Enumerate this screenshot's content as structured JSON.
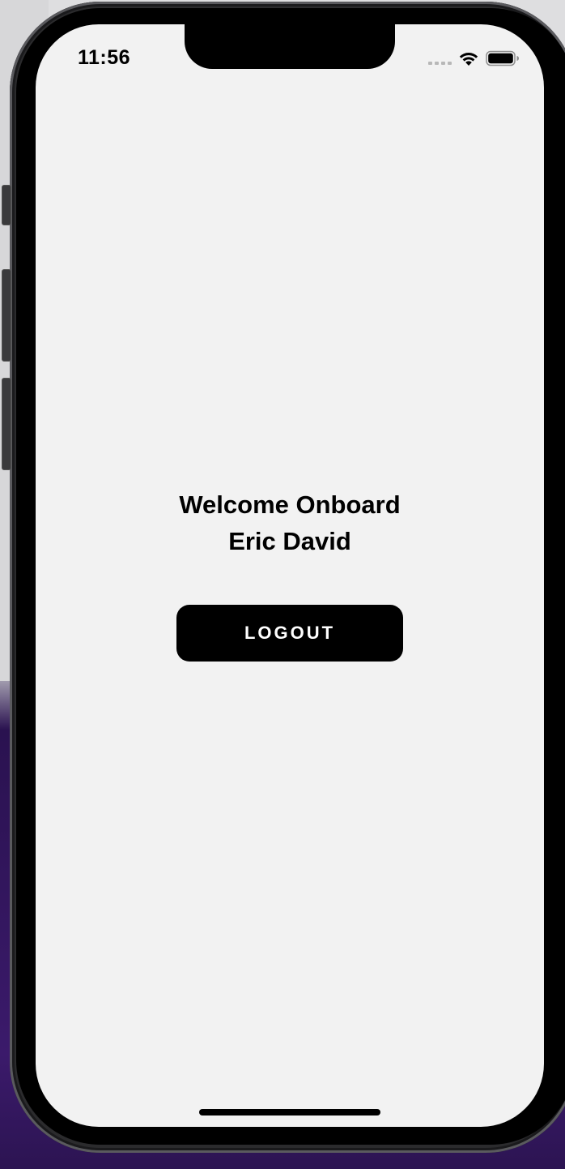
{
  "status_bar": {
    "time": "11:56",
    "icons": [
      "cellular-signal-icon",
      "wifi-icon",
      "battery-icon"
    ]
  },
  "main": {
    "welcome_title": "Welcome Onboard",
    "user_name": "Eric David",
    "logout_label": "LOGOUT"
  },
  "colors": {
    "screen_background": "#f2f2f2",
    "button_background": "#000000",
    "button_text": "#ffffff",
    "text": "#000000"
  }
}
